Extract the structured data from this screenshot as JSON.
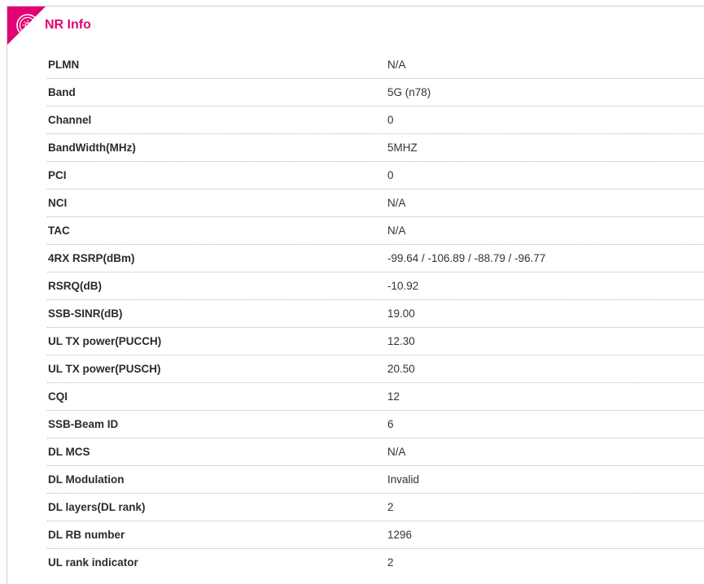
{
  "panel": {
    "title": "NR Info",
    "accent": "#e20074",
    "icon": "settings-badge-icon"
  },
  "rows": [
    {
      "label": "PLMN",
      "value": "N/A"
    },
    {
      "label": "Band",
      "value": "5G (n78)"
    },
    {
      "label": "Channel",
      "value": "0"
    },
    {
      "label": "BandWidth(MHz)",
      "value": "5MHZ"
    },
    {
      "label": "PCI",
      "value": "0"
    },
    {
      "label": "NCI",
      "value": "N/A"
    },
    {
      "label": "TAC",
      "value": "N/A"
    },
    {
      "label": "4RX RSRP(dBm)",
      "value": "-99.64 / -106.89 / -88.79 / -96.77"
    },
    {
      "label": "RSRQ(dB)",
      "value": "-10.92"
    },
    {
      "label": "SSB-SINR(dB)",
      "value": "19.00"
    },
    {
      "label": "UL TX power(PUCCH)",
      "value": "12.30"
    },
    {
      "label": "UL TX power(PUSCH)",
      "value": "20.50"
    },
    {
      "label": "CQI",
      "value": "12"
    },
    {
      "label": "SSB-Beam ID",
      "value": "6"
    },
    {
      "label": "DL MCS",
      "value": "N/A"
    },
    {
      "label": "DL Modulation",
      "value": "Invalid"
    },
    {
      "label": "DL layers(DL rank)",
      "value": "2"
    },
    {
      "label": "DL RB number",
      "value": "1296"
    },
    {
      "label": "UL rank indicator",
      "value": "2"
    }
  ]
}
